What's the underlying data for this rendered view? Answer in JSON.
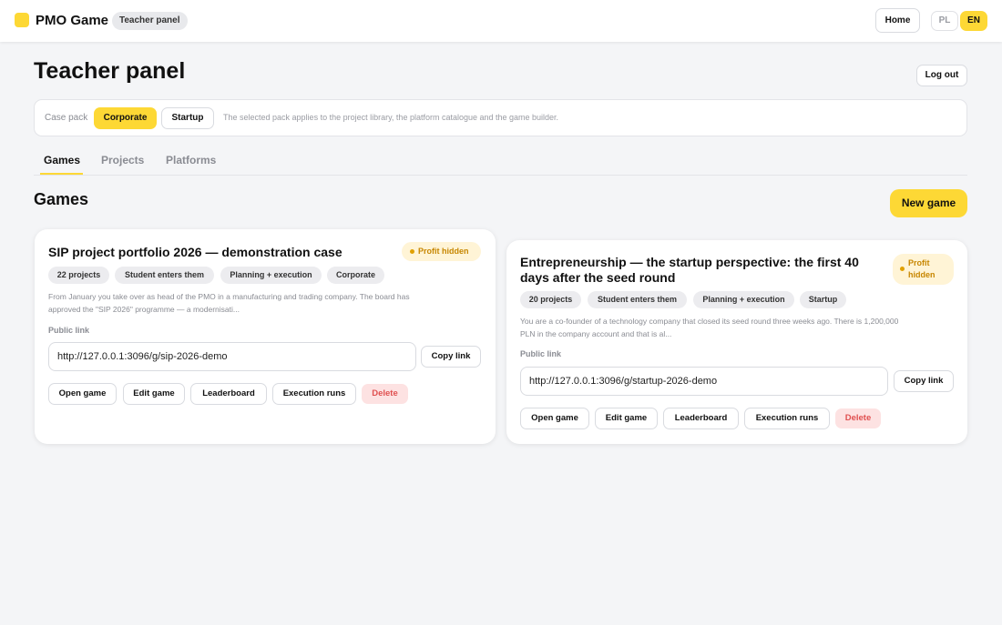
{
  "header": {
    "brand": "PMO Game",
    "badge": "Teacher panel",
    "home_label": "Home",
    "langs": [
      "PL",
      "EN"
    ],
    "active_lang": "EN"
  },
  "page": {
    "title": "Teacher panel",
    "logout_label": "Log out"
  },
  "case_pack": {
    "label": "Case pack",
    "options": [
      "Corporate",
      "Startup"
    ],
    "selected": "Corporate",
    "note": "The selected pack applies to the project library, the platform catalogue and the game builder."
  },
  "tabs": [
    {
      "label": "Games",
      "active": true
    },
    {
      "label": "Projects",
      "active": false
    },
    {
      "label": "Platforms",
      "active": false
    }
  ],
  "section": {
    "title": "Games",
    "new_game_label": "New game"
  },
  "games": [
    {
      "title": "SIP project portfolio 2026 — demonstration case",
      "badge": "Profit hidden",
      "tags": [
        "22 projects",
        "Student enters them",
        "Planning + execution",
        "Corporate"
      ],
      "desc_line1": "From January you take over as head of the PMO in a manufacturing and trading company. The board has",
      "desc_line2": "approved the \"SIP 2026\" programme — a modernisati...",
      "link_label": "Public link",
      "url": "http://127.0.0.1:3096/g/sip-2026-demo",
      "copy_label": "Copy link",
      "actions": [
        "Open game",
        "Edit game",
        "Leaderboard",
        "Execution runs"
      ],
      "delete_label": "Delete"
    },
    {
      "title_line1": "Entrepreneurship — the startup perspective: the first 40",
      "title_line2": "days after the seed round",
      "badge_line1": "Profit",
      "badge_line2": "hidden",
      "tags": [
        "20 projects",
        "Student enters them",
        "Planning + execution",
        "Startup"
      ],
      "desc_line1": "You are a co-founder of a technology company that closed its seed round three weeks ago. There is 1,200,000",
      "desc_line2": "PLN in the company account and that is al...",
      "link_label": "Public link",
      "url": "http://127.0.0.1:3096/g/startup-2026-demo",
      "copy_label": "Copy link",
      "actions": [
        "Open game",
        "Edit game",
        "Leaderboard",
        "Execution runs"
      ],
      "delete_label": "Delete"
    }
  ],
  "colors": {
    "accent": "#fdd835",
    "badge_text": "#c78600",
    "danger": "#e05050"
  }
}
